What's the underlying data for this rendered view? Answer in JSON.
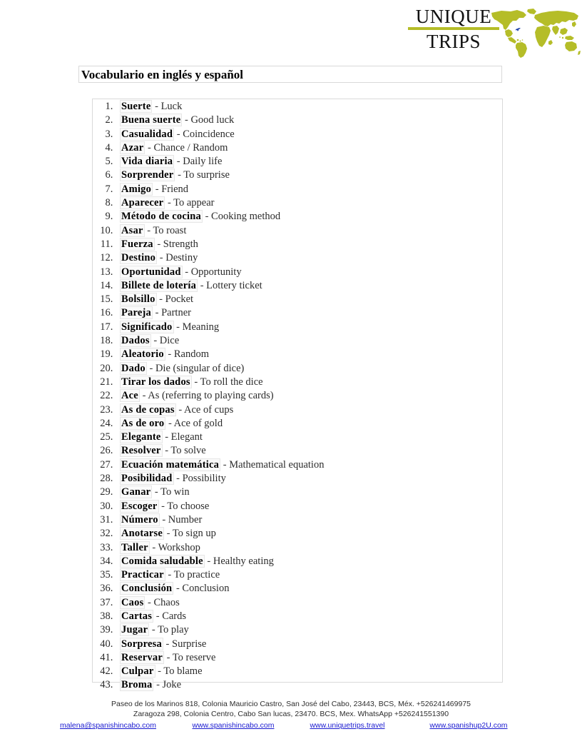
{
  "logo": {
    "line1": "UNIQUE",
    "line2": "TRIPS",
    "map_icon": "world-map-icon",
    "accent_color": "#b5bd28",
    "text_color": "#111111"
  },
  "title": {
    "heading": "Vocabulario en inglés y español"
  },
  "list": {
    "items": [
      {
        "n": 1,
        "term": "Suerte",
        "sep": "-",
        "gloss": "Luck"
      },
      {
        "n": 2,
        "term": "Buena suerte",
        "sep": "-",
        "gloss": "Good luck"
      },
      {
        "n": 3,
        "term": "Casualidad",
        "sep": "-",
        "gloss": "Coincidence"
      },
      {
        "n": 4,
        "term": "Azar",
        "sep": "-",
        "gloss": "Chance / Random"
      },
      {
        "n": 5,
        "term": "Vida diaria",
        "sep": "-",
        "gloss": "Daily life"
      },
      {
        "n": 6,
        "term": "Sorprender",
        "sep": "-",
        "gloss": "To surprise"
      },
      {
        "n": 7,
        "term": "Amigo",
        "sep": "-",
        "gloss": "Friend"
      },
      {
        "n": 8,
        "term": "Aparecer",
        "sep": "-",
        "gloss": "To appear"
      },
      {
        "n": 9,
        "term": "Método de cocina",
        "sep": "-",
        "gloss": "Cooking method"
      },
      {
        "n": 10,
        "term": "Asar",
        "sep": "-",
        "gloss": "To roast"
      },
      {
        "n": 11,
        "term": "Fuerza",
        "sep": "-",
        "gloss": "Strength"
      },
      {
        "n": 12,
        "term": "Destino",
        "sep": "-",
        "gloss": "Destiny"
      },
      {
        "n": 13,
        "term": "Oportunidad",
        "sep": "-",
        "gloss": "Opportunity"
      },
      {
        "n": 14,
        "term": "Billete de lotería",
        "sep": "-",
        "gloss": "Lottery ticket"
      },
      {
        "n": 15,
        "term": "Bolsillo",
        "sep": "-",
        "gloss": "Pocket"
      },
      {
        "n": 16,
        "term": "Pareja",
        "sep": "-",
        "gloss": "Partner"
      },
      {
        "n": 17,
        "term": "Significado",
        "sep": "-",
        "gloss": "Meaning"
      },
      {
        "n": 18,
        "term": "Dados",
        "sep": "-",
        "gloss": "Dice"
      },
      {
        "n": 19,
        "term": "Aleatorio",
        "sep": "-",
        "gloss": "Random"
      },
      {
        "n": 20,
        "term": "Dado",
        "sep": "-",
        "gloss": "Die (singular of dice)"
      },
      {
        "n": 21,
        "term": "Tirar los dados",
        "sep": "-",
        "gloss": "To roll the dice"
      },
      {
        "n": 22,
        "term": "Ace",
        "sep": "-",
        "gloss": "As (referring to playing cards)"
      },
      {
        "n": 23,
        "term": "As de copas",
        "sep": "-",
        "gloss": "Ace of cups"
      },
      {
        "n": 24,
        "term": "As de oro",
        "sep": "-",
        "gloss": "Ace of gold"
      },
      {
        "n": 25,
        "term": "Elegante",
        "sep": "-",
        "gloss": "Elegant"
      },
      {
        "n": 26,
        "term": "Resolver",
        "sep": "-",
        "gloss": "To solve"
      },
      {
        "n": 27,
        "term": "Ecuación matemática",
        "sep": "-",
        "gloss": "Mathematical equation"
      },
      {
        "n": 28,
        "term": "Posibilidad",
        "sep": "-",
        "gloss": "Possibility"
      },
      {
        "n": 29,
        "term": "Ganar",
        "sep": "-",
        "gloss": "To win"
      },
      {
        "n": 30,
        "term": "Escoger",
        "sep": "-",
        "gloss": "To choose"
      },
      {
        "n": 31,
        "term": "Número",
        "sep": "-",
        "gloss": "Number"
      },
      {
        "n": 32,
        "term": "Anotarse",
        "sep": "-",
        "gloss": "To sign up"
      },
      {
        "n": 33,
        "term": "Taller",
        "sep": "-",
        "gloss": "Workshop"
      },
      {
        "n": 34,
        "term": "Comida saludable",
        "sep": "-",
        "gloss": "Healthy eating"
      },
      {
        "n": 35,
        "term": "Practicar",
        "sep": "-",
        "gloss": "To practice"
      },
      {
        "n": 36,
        "term": "Conclusión",
        "sep": "-",
        "gloss": "Conclusion"
      },
      {
        "n": 37,
        "term": "Caos",
        "sep": "-",
        "gloss": "Chaos"
      },
      {
        "n": 38,
        "term": "Cartas",
        "sep": "-",
        "gloss": "Cards"
      },
      {
        "n": 39,
        "term": "Jugar",
        "sep": "-",
        "gloss": "To play"
      },
      {
        "n": 40,
        "term": "Sorpresa",
        "sep": "-",
        "gloss": "Surprise"
      },
      {
        "n": 41,
        "term": "Reservar",
        "sep": "-",
        "gloss": "To reserve"
      },
      {
        "n": 42,
        "term": "Culpar",
        "sep": "-",
        "gloss": "To blame"
      },
      {
        "n": 43,
        "term": "Broma",
        "sep": "-",
        "gloss": "Joke"
      }
    ]
  },
  "footer": {
    "address_line1": "Paseo de los Marinos 818, Colonia Mauricio Castro, San José del Cabo, 23443, BCS, Méx. +526241469975",
    "address_line2": "Zaragoza 298, Colonia Centro, Cabo San lucas, 23470. BCS, Mex. WhatsApp +526241551390",
    "links": [
      {
        "label": "malena@spanishincabo.com"
      },
      {
        "label": "www.spanishincabo.com"
      },
      {
        "label": "www.uniquetrips.travel"
      },
      {
        "label": "www.spanishup2U.com"
      }
    ],
    "link_color": "#1a1ad0"
  }
}
